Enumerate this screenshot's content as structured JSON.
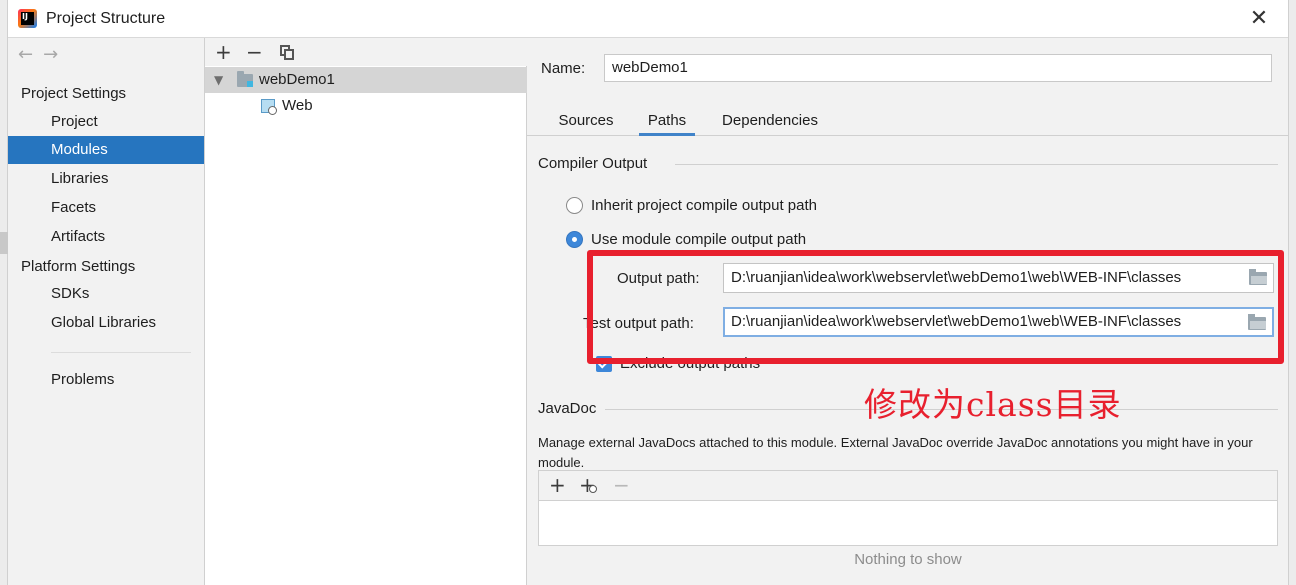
{
  "window": {
    "title": "Project Structure",
    "close_glyph": "✕"
  },
  "nav": {
    "back_glyph": "←",
    "forward_glyph": "→",
    "project_settings_header": "Project Settings",
    "project_settings_items": [
      "Project",
      "Modules",
      "Libraries",
      "Facets",
      "Artifacts"
    ],
    "platform_settings_header": "Platform Settings",
    "platform_settings_items": [
      "SDKs",
      "Global Libraries"
    ],
    "problems_label": "Problems",
    "selected_item": "Modules"
  },
  "tree": {
    "add_glyph": "+",
    "remove_glyph": "−",
    "nodes": [
      {
        "label": "webDemo1",
        "expanded": true,
        "selected": true,
        "icon": "module-folder-icon"
      },
      {
        "label": "Web",
        "icon": "web-facet-icon"
      }
    ]
  },
  "module": {
    "name_label": "Name:",
    "name_value": "webDemo1",
    "tabs": [
      "Sources",
      "Paths",
      "Dependencies"
    ],
    "active_tab": "Paths"
  },
  "compiler_output": {
    "section_title": "Compiler Output",
    "inherit_label": "Inherit project compile output path",
    "use_module_label": "Use module compile output path",
    "selected_option": "Use module compile output path",
    "output_path_label": "Output path:",
    "output_path_value": "D:\\ruanjian\\idea\\work\\webservlet\\webDemo1\\web\\WEB-INF\\classes",
    "test_output_path_label": "Test output path:",
    "test_output_path_value": "D:\\ruanjian\\idea\\work\\webservlet\\webDemo1\\web\\WEB-INF\\classes",
    "exclude_label": "Exclude output paths",
    "exclude_checked": true
  },
  "annotation": {
    "text": "修改为class目录",
    "color": "#e8202e"
  },
  "javadoc": {
    "section_title": "JavaDoc",
    "description": "Manage external JavaDocs attached to this module. External JavaDoc override JavaDoc annotations you might have in your module.",
    "add_glyph": "+",
    "add_url_glyph": "+",
    "remove_glyph": "−",
    "empty_text": "Nothing to show"
  },
  "colors": {
    "selection": "#2675bf",
    "accent": "#3d87d9",
    "highlight": "#e8202e"
  }
}
